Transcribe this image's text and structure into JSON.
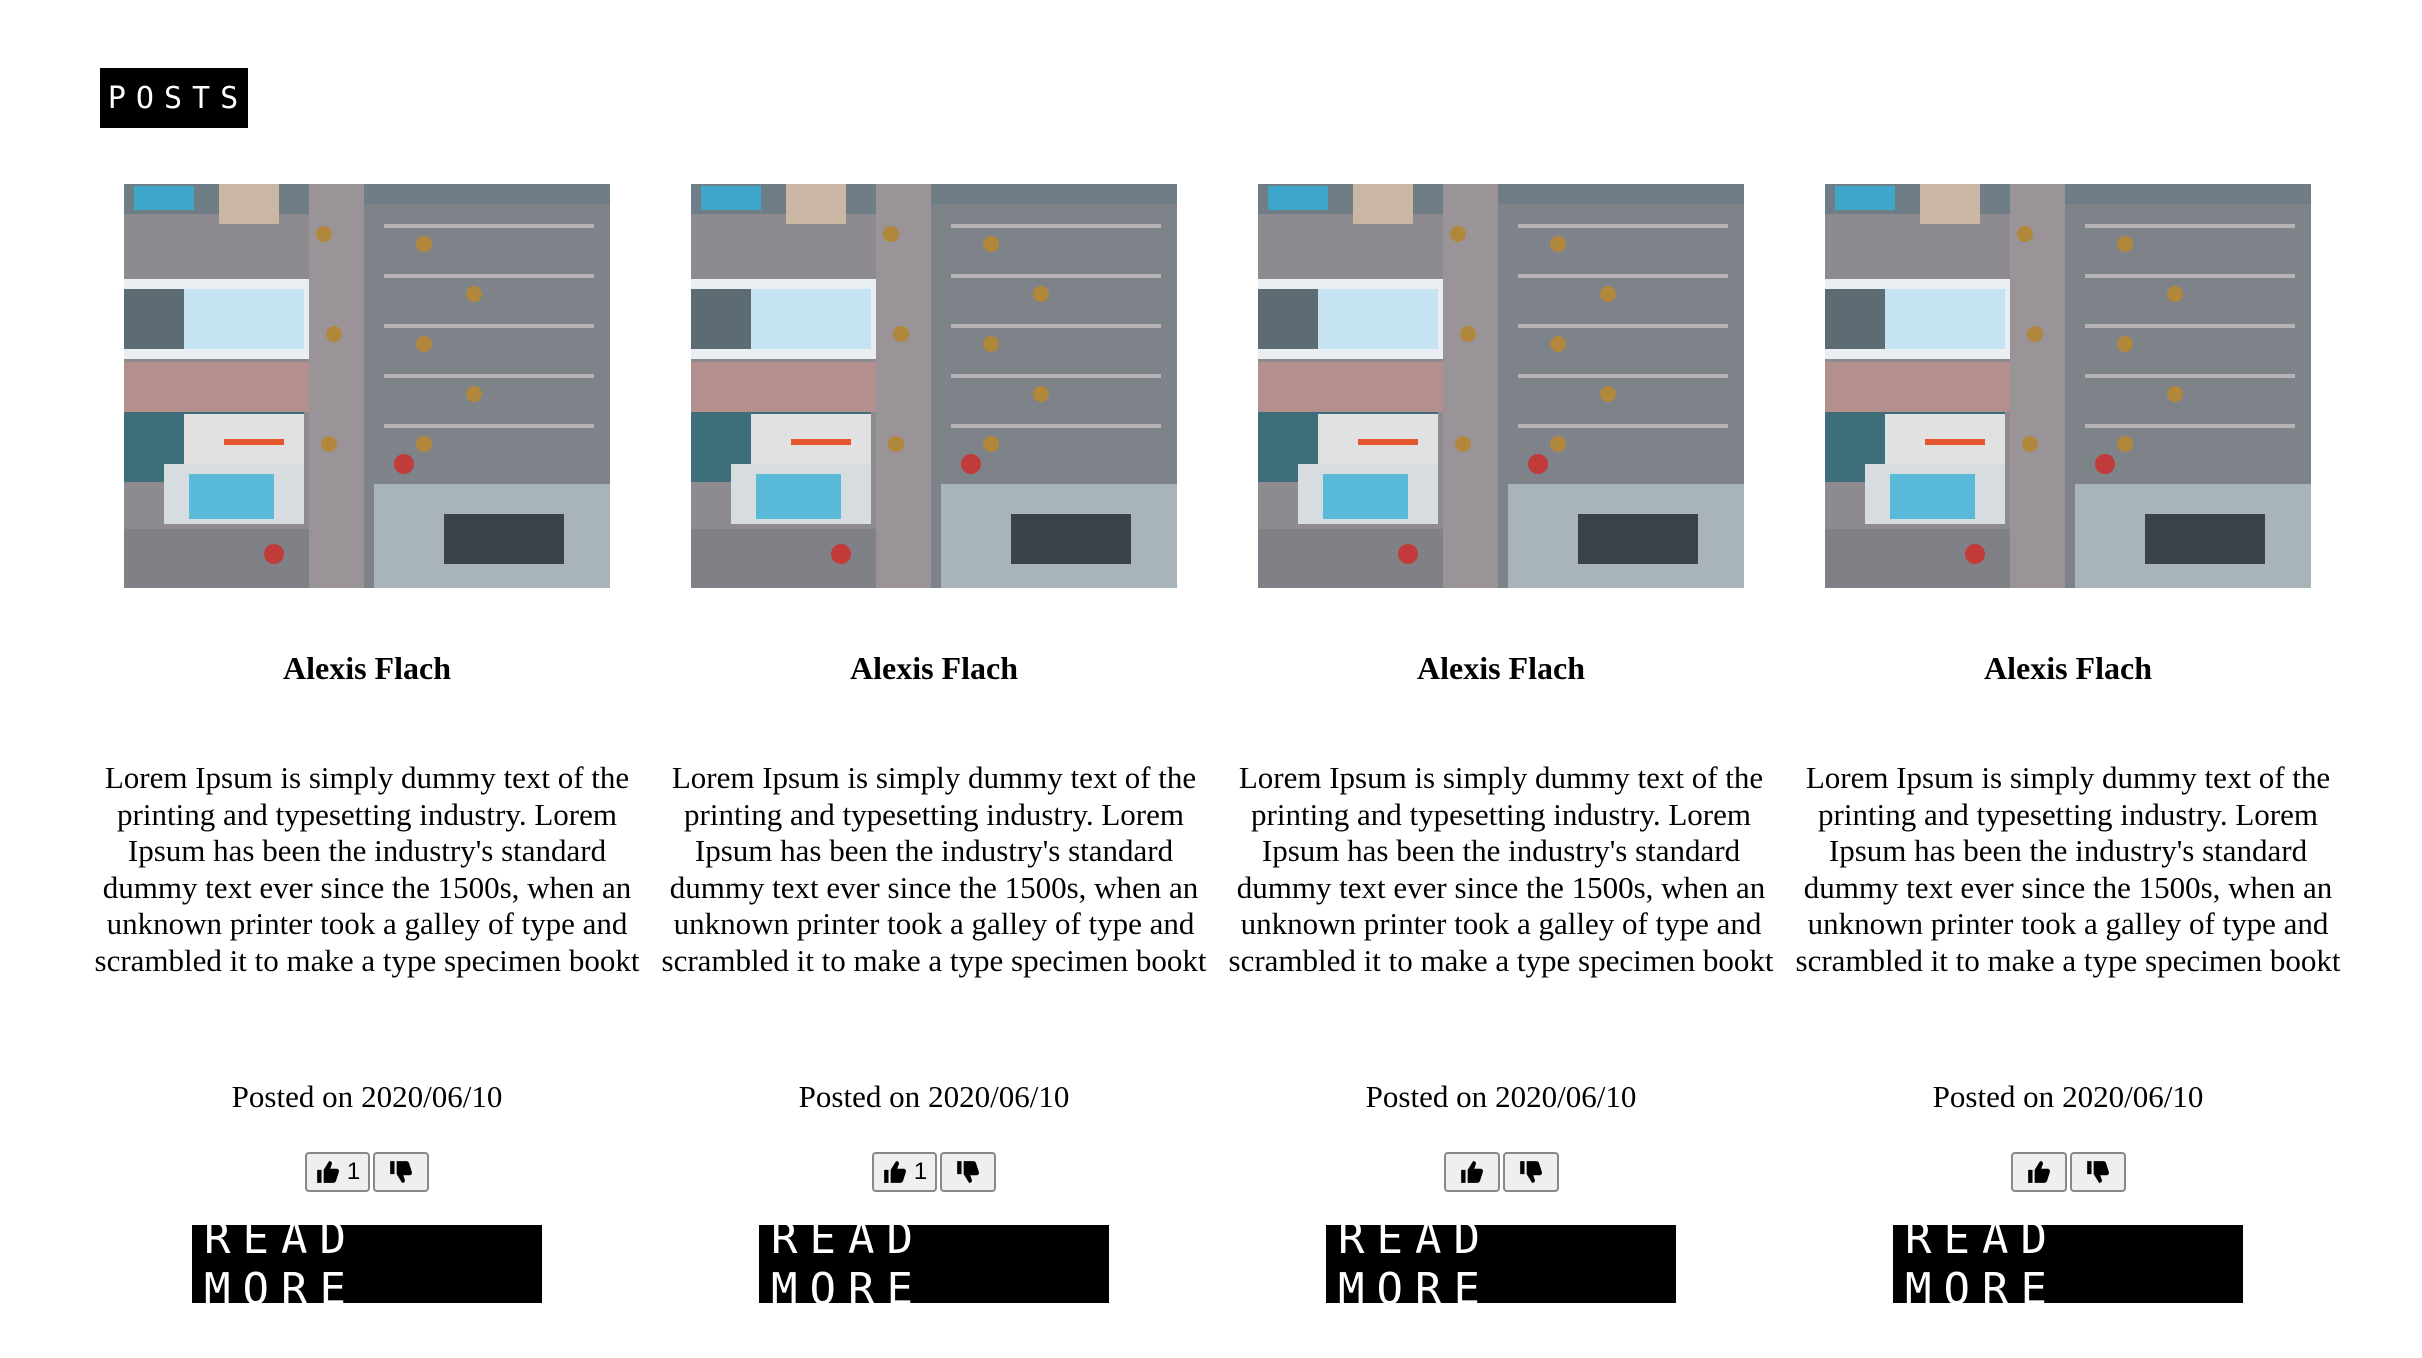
{
  "header": {
    "badge_label": "POSTS"
  },
  "posts": [
    {
      "author": "Alexis Flach",
      "excerpt": "Lorem Ipsum is simply dummy text of the printing and typesetting industry. Lorem Ipsum has been the industry's standard dummy text ever since the 1500s, when an unknown printer took a galley of type and scrambled it to make a type specimen bookt",
      "posted_prefix": "Posted on",
      "posted_date": "2020/06/10",
      "like_count": "1",
      "read_more_label": "READ MORE"
    },
    {
      "author": "Alexis Flach",
      "excerpt": "Lorem Ipsum is simply dummy text of the printing and typesetting industry. Lorem Ipsum has been the industry's standard dummy text ever since the 1500s, when an unknown printer took a galley of type and scrambled it to make a type specimen bookt",
      "posted_prefix": "Posted on",
      "posted_date": "2020/06/10",
      "like_count": "1",
      "read_more_label": "READ MORE"
    },
    {
      "author": "Alexis Flach",
      "excerpt": "Lorem Ipsum is simply dummy text of the printing and typesetting industry. Lorem Ipsum has been the industry's standard dummy text ever since the 1500s, when an unknown printer took a galley of type and scrambled it to make a type specimen bookt",
      "posted_prefix": "Posted on",
      "posted_date": "2020/06/10",
      "like_count": "",
      "read_more_label": "READ MORE"
    },
    {
      "author": "Alexis Flach",
      "excerpt": "Lorem Ipsum is simply dummy text of the printing and typesetting industry. Lorem Ipsum has been the industry's standard dummy text ever since the 1500s, when an unknown printer took a galley of type and scrambled it to make a type specimen bookt",
      "posted_prefix": "Posted on",
      "posted_date": "2020/06/10",
      "like_count": "",
      "read_more_label": "READ MORE"
    }
  ],
  "icons": {
    "like": "thumbs-up-icon",
    "dislike": "thumbs-down-icon",
    "image": "aerial-city-photo"
  },
  "colors": {
    "badge_bg": "#000000",
    "badge_text": "#ffffff",
    "page_bg": "#ffffff"
  }
}
